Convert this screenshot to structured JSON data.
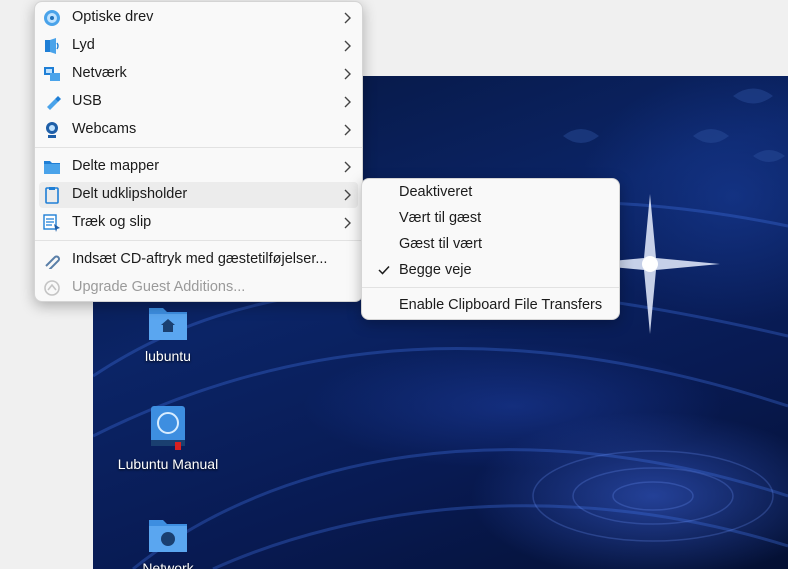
{
  "main_menu": {
    "items": [
      {
        "label": "Optiske drev",
        "icon": "optical-disc-icon",
        "submenu": true
      },
      {
        "label": "Lyd",
        "icon": "audio-icon",
        "submenu": true
      },
      {
        "label": "Netværk",
        "icon": "network-icon",
        "submenu": true
      },
      {
        "label": "USB",
        "icon": "usb-icon",
        "submenu": true
      },
      {
        "label": "Webcams",
        "icon": "webcam-icon",
        "submenu": true
      },
      {
        "label": "Delte mapper",
        "icon": "shared-folder-icon",
        "submenu": true
      },
      {
        "label": "Delt udklipsholder",
        "icon": "clipboard-icon",
        "submenu": true,
        "highlighted": true
      },
      {
        "label": "Træk og slip",
        "icon": "drag-drop-icon",
        "submenu": true
      },
      {
        "label": "Indsæt CD-aftryk med gæstetilføjelser...",
        "icon": "insert-cd-icon"
      },
      {
        "label": "Upgrade Guest Additions...",
        "icon": "upgrade-icon",
        "disabled": true
      }
    ]
  },
  "clipboard_submenu": {
    "items": [
      {
        "label": "Deaktiveret",
        "checked": false
      },
      {
        "label": "Vært til gæst",
        "checked": false
      },
      {
        "label": "Gæst til vært",
        "checked": false
      },
      {
        "label": "Begge veje",
        "checked": true
      },
      {
        "label": "Enable Clipboard File Transfers",
        "checked": false
      }
    ]
  },
  "desktop": {
    "icons": [
      {
        "label": "lubuntu",
        "icon": "home-folder-icon"
      },
      {
        "label": "Lubuntu Manual",
        "icon": "manual-book-icon"
      },
      {
        "label": "Network",
        "icon": "network-folder-icon"
      }
    ]
  },
  "colors": {
    "menu_bg": "#f9f9f9",
    "highlight": "#ececec",
    "accent_blue": "#1f7fd6",
    "desktop_blue": "#0b2466"
  }
}
